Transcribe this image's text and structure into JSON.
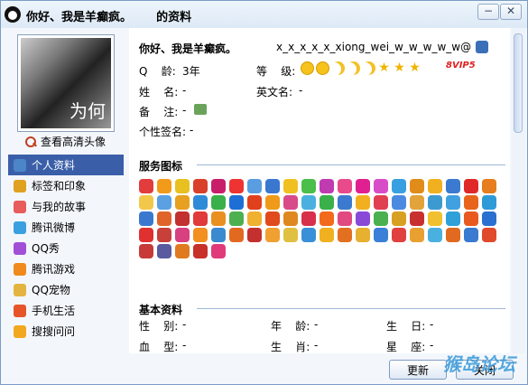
{
  "window": {
    "title": "你好、我是羊癫疯。      的资料",
    "min_glyph": "−",
    "close_glyph": "✕"
  },
  "sidebar": {
    "avatar_caption": "为何",
    "hd_avatar_link": "查看高清头像",
    "items": [
      {
        "label": "个人资料",
        "icon": "profile-card-icon",
        "color": "#4a86c8",
        "active": true
      },
      {
        "label": "标签和印象",
        "icon": "tag-icon",
        "color": "#e0a020"
      },
      {
        "label": "与我的故事",
        "icon": "rainbow-icon",
        "color": "#e85c5c"
      },
      {
        "label": "腾讯微博",
        "icon": "weibo-icon",
        "color": "#3aa0e0"
      },
      {
        "label": "QQ秀",
        "icon": "qqshow-icon",
        "color": "#a24fd8"
      },
      {
        "label": "腾讯游戏",
        "icon": "game-icon",
        "color": "#f08a1c"
      },
      {
        "label": "QQ宠物",
        "icon": "pet-icon",
        "color": "#e3b540"
      },
      {
        "label": "手机生活",
        "icon": "check-icon",
        "color": "#e6552a"
      },
      {
        "label": "搜搜问问",
        "icon": "question-icon",
        "color": "#f2a81e"
      }
    ]
  },
  "profile": {
    "nickname": "你好、我是羊癫疯。",
    "email": "x_x_x_x_x_xiong_wei_w_w_w_w_w@",
    "q_age_label": "Q    龄:",
    "q_age_value": "3年",
    "level_label": "等    级:",
    "level_icons": [
      "sun",
      "sun",
      "moon",
      "moon",
      "moon",
      "star",
      "star",
      "star"
    ],
    "vip_badge": "8VIP5",
    "name_label": "姓    名:",
    "name_value": "-",
    "english_name_label": "英文名:",
    "english_name_value": "-",
    "note_label": "备    注:",
    "note_value": "-",
    "signature_label": "个性签名:",
    "signature_value": "-"
  },
  "services": {
    "title": "服务图标",
    "icon_colors": [
      "#e23c3c",
      "#f29a1a",
      "#e8c020",
      "#d9402a",
      "#c81e6a",
      "#e33",
      "#5a9de0",
      "#3a78d0",
      "#f0c020",
      "#4abf4a",
      "#c03ab0",
      "#e84a8a",
      "#e02090",
      "#d94cc8",
      "#38a0e0",
      "#e08c1a",
      "#f0b020",
      "#3a7ad0",
      "#e02828",
      "#e67d1e",
      "#f2c84a",
      "#5aa0e2",
      "#e8a020",
      "#2f8bd8",
      "#3ab04a",
      "#1d6fd6",
      "#e0401c",
      "#f09a1a",
      "#d84a8a",
      "#4ab0e0",
      "#3ab04a",
      "#3c7ad0",
      "#f2b020",
      "#e04050",
      "#4a8ae0",
      "#e2a33a",
      "#3c9ad0",
      "#40a0e0",
      "#e8641c",
      "#2f9ad8",
      "#3a78d0",
      "#e0642a",
      "#c23030",
      "#e03a3a",
      "#e89020",
      "#4cb050",
      "#f0b030",
      "#e04a1c",
      "#e08820",
      "#d8304a",
      "#f26a1a",
      "#e04a80",
      "#8a4ad8",
      "#4ab050",
      "#d8a020",
      "#c83030",
      "#f0c030",
      "#2fa0d8",
      "#e85a20",
      "#2a70d0",
      "#e03030",
      "#c8403a",
      "#d84080",
      "#f29020",
      "#3a8ad0",
      "#e26a20",
      "#c42f2f",
      "#f0a030",
      "#e0c040",
      "#3a90d8",
      "#f0b020",
      "#e27020",
      "#e8b030",
      "#3a80d8",
      "#e04040",
      "#e8a030",
      "#4ab0e0",
      "#e06a20",
      "#3a7ad0",
      "#e04a2a",
      "#c83a3a",
      "#5a5aa0",
      "#e07a20",
      "#c8302a",
      "#e03a7a"
    ]
  },
  "basic": {
    "title": "基本资料",
    "gender_label": "性    别:",
    "gender_value": "-",
    "age_label": "年    龄:",
    "age_value": "-",
    "birthday_label": "生    日:",
    "birthday_value": "-",
    "blood_label": "血    型:",
    "blood_value": "-",
    "zodiac_label": "生    肖:",
    "zodiac_value": "-",
    "constellation_label": "星    座:",
    "constellation_value": "-"
  },
  "footer": {
    "refresh_label": "更新",
    "close_label": "关闭",
    "watermark": "猴岛论坛"
  }
}
